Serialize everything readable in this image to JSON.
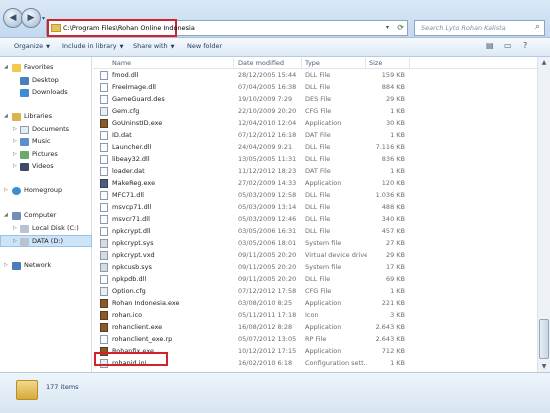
{
  "address": {
    "path": "C:\\Program Files\\Rohan Online Indonesia",
    "search_placeholder": "Search Lyto Rohan Kalista"
  },
  "toolbar": {
    "organize": "Organize",
    "include": "Include in library",
    "share": "Share with",
    "new_folder": "New folder"
  },
  "nav": {
    "favorites": "Favorites",
    "desktop": "Desktop",
    "downloads": "Downloads",
    "libraries": "Libraries",
    "documents": "Documents",
    "music": "Music",
    "pictures": "Pictures",
    "videos": "Videos",
    "homegroup": "Homegroup",
    "computer": "Computer",
    "local_disk": "Local Disk (C:)",
    "data": "DATA (D:)",
    "network": "Network"
  },
  "columns": {
    "name": "Name",
    "date": "Date modified",
    "type": "Type",
    "size": "Size"
  },
  "files": [
    {
      "name": "fmod.dll",
      "date": "28/12/2005 15:44",
      "type": "DLL File",
      "size": "159 KB",
      "icon": "file"
    },
    {
      "name": "FreeImage.dll",
      "date": "07/04/2005 16:38",
      "type": "DLL File",
      "size": "884 KB",
      "icon": "file"
    },
    {
      "name": "GameGuard.des",
      "date": "19/10/2009 7:29",
      "type": "DES File",
      "size": "29 KB",
      "icon": "file"
    },
    {
      "name": "Gem.cfg",
      "date": "22/10/2009 20:20",
      "type": "CFG File",
      "size": "1 KB",
      "icon": "cfg"
    },
    {
      "name": "GoUninstID.exe",
      "date": "12/04/2010 12:04",
      "type": "Application",
      "size": "30 KB",
      "icon": "img"
    },
    {
      "name": "ID.dat",
      "date": "07/12/2012 16:18",
      "type": "DAT File",
      "size": "1 KB",
      "icon": "file"
    },
    {
      "name": "Launcher.dll",
      "date": "24/04/2009 9:21",
      "type": "DLL File",
      "size": "7.116 KB",
      "icon": "file"
    },
    {
      "name": "libeay32.dll",
      "date": "13/05/2005 11:31",
      "type": "DLL File",
      "size": "836 KB",
      "icon": "file"
    },
    {
      "name": "loader.dat",
      "date": "11/12/2012 18:23",
      "type": "DAT File",
      "size": "1 KB",
      "icon": "file"
    },
    {
      "name": "MakeReg.exe",
      "date": "27/02/2009 14:33",
      "type": "Application",
      "size": "120 KB",
      "icon": "exe"
    },
    {
      "name": "MFC71.dll",
      "date": "05/03/2009 12:58",
      "type": "DLL File",
      "size": "1.036 KB",
      "icon": "file"
    },
    {
      "name": "msvcp71.dll",
      "date": "05/03/2009 13:14",
      "type": "DLL File",
      "size": "488 KB",
      "icon": "file"
    },
    {
      "name": "msvcr71.dll",
      "date": "05/03/2009 12:46",
      "type": "DLL File",
      "size": "340 KB",
      "icon": "file"
    },
    {
      "name": "npkcrypt.dll",
      "date": "03/05/2006 16:31",
      "type": "DLL File",
      "size": "457 KB",
      "icon": "file"
    },
    {
      "name": "npkcrypt.sys",
      "date": "03/05/2006 18:01",
      "type": "System file",
      "size": "27 KB",
      "icon": "sys"
    },
    {
      "name": "npkcrypt.vxd",
      "date": "09/11/2005 20:20",
      "type": "Virtual device driver",
      "size": "29 KB",
      "icon": "sys"
    },
    {
      "name": "npkcusb.sys",
      "date": "09/11/2005 20:20",
      "type": "System file",
      "size": "17 KB",
      "icon": "sys"
    },
    {
      "name": "npkpdb.dll",
      "date": "09/11/2005 20:20",
      "type": "DLL File",
      "size": "69 KB",
      "icon": "file"
    },
    {
      "name": "Option.cfg",
      "date": "07/12/2012 17:58",
      "type": "CFG File",
      "size": "1 KB",
      "icon": "cfg"
    },
    {
      "name": "Rohan Indonesia.exe",
      "date": "03/08/2010 8:25",
      "type": "Application",
      "size": "221 KB",
      "icon": "img"
    },
    {
      "name": "rohan.ico",
      "date": "05/11/2011 17:18",
      "type": "Icon",
      "size": "3 KB",
      "icon": "img"
    },
    {
      "name": "rohanclient.exe",
      "date": "16/08/2012 8:28",
      "type": "Application",
      "size": "2.643 KB",
      "icon": "img"
    },
    {
      "name": "rohanclient_exe.rp",
      "date": "05/07/2012 13:05",
      "type": "RP File",
      "size": "2.643 KB",
      "icon": "file"
    },
    {
      "name": "Rohanfix.exe",
      "date": "10/12/2012 17:15",
      "type": "Application",
      "size": "712 KB",
      "icon": "img"
    },
    {
      "name": "rohanid.ini",
      "date": "16/02/2010 6:18",
      "type": "Configuration sett...",
      "size": "1 KB",
      "icon": "cfg"
    }
  ],
  "status": {
    "count": "177 items"
  }
}
